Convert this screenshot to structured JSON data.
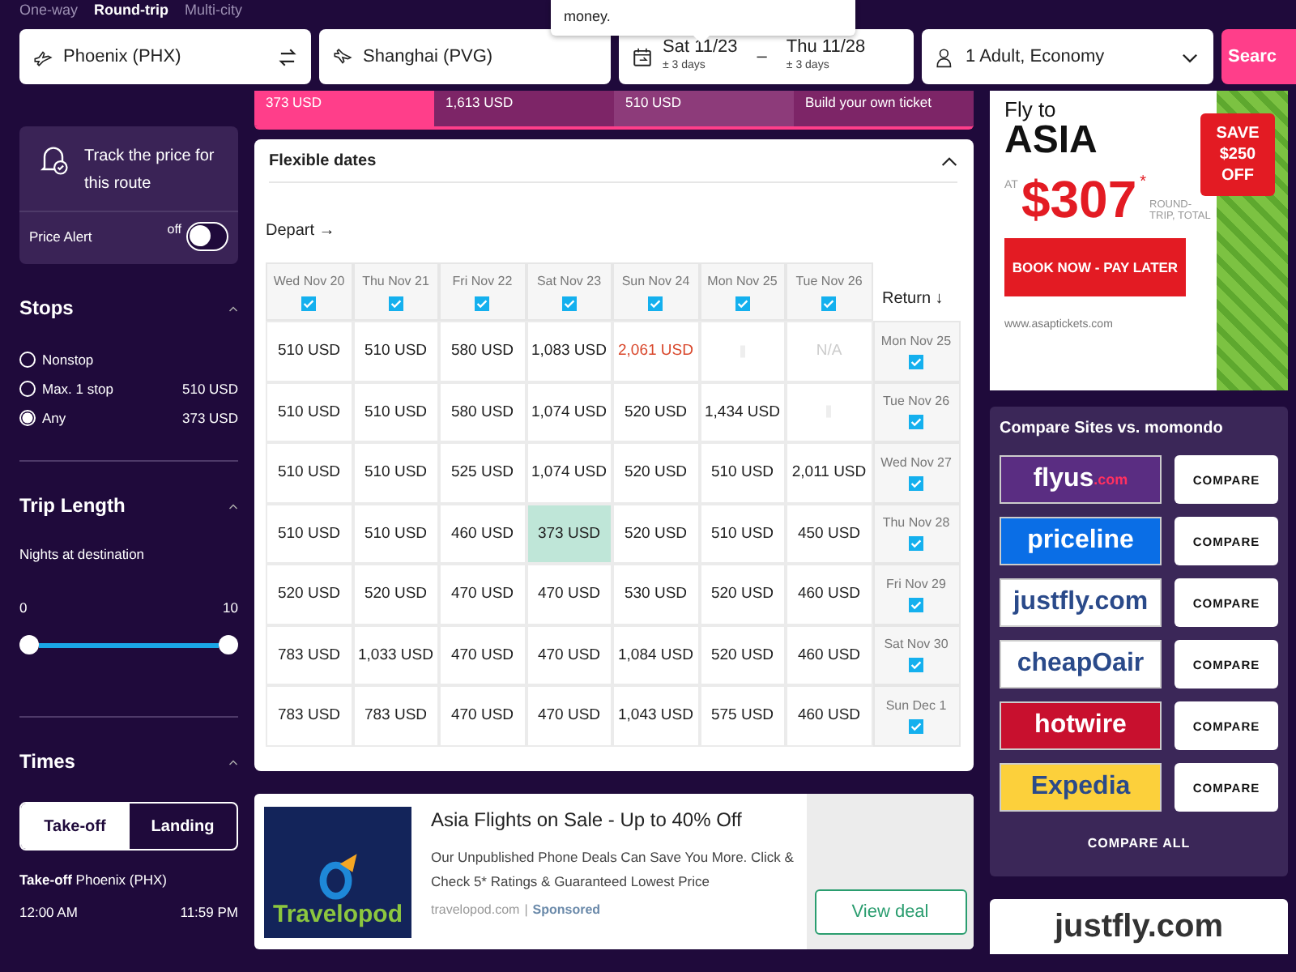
{
  "trip_types": [
    {
      "label": "One-way",
      "selected": false
    },
    {
      "label": "Round-trip",
      "selected": true
    },
    {
      "label": "Multi-city",
      "selected": false
    }
  ],
  "tooltip": {
    "text": "money."
  },
  "search": {
    "origin": "Phoenix (PHX)",
    "destination": "Shanghai (PVG)",
    "depart": {
      "date": "Sat 11/23",
      "flex": "± 3 days"
    },
    "separator": "–",
    "return": {
      "date": "Thu 11/28",
      "flex": "± 3 days"
    },
    "travelers": "1 Adult, Economy",
    "button": "Searc"
  },
  "sort_tabs": [
    {
      "label": "373 USD",
      "selected": true
    },
    {
      "label": "1,613 USD",
      "selected": false
    },
    {
      "label": "510 USD",
      "selected": false
    },
    {
      "label": "Build your own ticket",
      "selected": false
    }
  ],
  "price_alert": {
    "title": "Track the price for this route",
    "label": "Price Alert",
    "state_text": "off",
    "on": false
  },
  "stops": {
    "title": "Stops",
    "expanded": true,
    "options": [
      {
        "label": "Nonstop",
        "selected": false
      },
      {
        "label": "Max. 1 stop",
        "price": "510 USD",
        "selected": false
      },
      {
        "label": "Any",
        "price": "373 USD",
        "selected": true
      }
    ]
  },
  "trip_length": {
    "title": "Trip Length",
    "expanded": true,
    "subtitle": "Nights at destination",
    "min_label": "0",
    "max_label": "10",
    "thumbs": [
      {
        "level": 0
      },
      {
        "level": 1
      }
    ]
  },
  "times": {
    "title": "Times",
    "expanded": true,
    "tabs": [
      {
        "label": "Take-off",
        "selected": true
      },
      {
        "label": "Landing",
        "selected": false
      }
    ],
    "caption": "**Take-off** Phoenix (PHX)",
    "start": "12:00 AM",
    "end": "11:59 PM"
  },
  "flexible_dates": {
    "title": "Flexible dates",
    "expanded": true,
    "depart_label": "Depart →",
    "return_label": "Return ↓",
    "columns": [
      {
        "label": "Wed Nov 20",
        "checked": true
      },
      {
        "label": "Thu Nov 21",
        "checked": true
      },
      {
        "label": "Fri Nov 22",
        "checked": true
      },
      {
        "label": "Sat Nov 23",
        "checked": true
      },
      {
        "label": "Sun Nov 24",
        "checked": true
      },
      {
        "label": "Mon Nov 25",
        "checked": true
      },
      {
        "label": "Tue Nov 26",
        "checked": true
      }
    ],
    "rows": [
      {
        "label": "Mon Nov 25",
        "checked": true,
        "cells": [
          {
            "kind": "price",
            "text": "510 USD"
          },
          {
            "kind": "price",
            "text": "510 USD"
          },
          {
            "kind": "price",
            "text": "580 USD"
          },
          {
            "kind": "price",
            "text": "1,083 USD"
          },
          {
            "kind": "high",
            "text": "2,061 USD"
          },
          {
            "kind": "blank"
          },
          {
            "kind": "na",
            "text": "N/A"
          }
        ]
      },
      {
        "label": "Tue Nov 26",
        "checked": true,
        "cells": [
          {
            "kind": "price",
            "text": "510 USD"
          },
          {
            "kind": "price",
            "text": "510 USD"
          },
          {
            "kind": "price",
            "text": "580 USD"
          },
          {
            "kind": "price",
            "text": "1,074 USD"
          },
          {
            "kind": "price",
            "text": "520 USD"
          },
          {
            "kind": "price",
            "text": "1,434 USD"
          },
          {
            "kind": "blank"
          }
        ]
      },
      {
        "label": "Wed Nov 27",
        "checked": true,
        "cells": [
          {
            "kind": "price",
            "text": "510 USD"
          },
          {
            "kind": "price",
            "text": "510 USD"
          },
          {
            "kind": "price",
            "text": "525 USD"
          },
          {
            "kind": "price",
            "text": "1,074 USD"
          },
          {
            "kind": "price",
            "text": "520 USD"
          },
          {
            "kind": "price",
            "text": "510 USD"
          },
          {
            "kind": "price",
            "text": "2,011 USD"
          }
        ]
      },
      {
        "label": "Thu Nov 28",
        "checked": true,
        "cells": [
          {
            "kind": "price",
            "text": "510 USD"
          },
          {
            "kind": "price",
            "text": "510 USD"
          },
          {
            "kind": "price",
            "text": "460 USD"
          },
          {
            "kind": "best",
            "text": "373 USD"
          },
          {
            "kind": "price",
            "text": "520 USD"
          },
          {
            "kind": "price",
            "text": "510 USD"
          },
          {
            "kind": "price",
            "text": "450 USD"
          }
        ]
      },
      {
        "label": "Fri Nov 29",
        "checked": true,
        "cells": [
          {
            "kind": "price",
            "text": "520 USD"
          },
          {
            "kind": "price",
            "text": "520 USD"
          },
          {
            "kind": "price",
            "text": "470 USD"
          },
          {
            "kind": "price",
            "text": "470 USD"
          },
          {
            "kind": "price",
            "text": "530 USD"
          },
          {
            "kind": "price",
            "text": "520 USD"
          },
          {
            "kind": "price",
            "text": "460 USD"
          }
        ]
      },
      {
        "label": "Sat Nov 30",
        "checked": true,
        "cells": [
          {
            "kind": "price",
            "text": "783 USD"
          },
          {
            "kind": "price",
            "text": "1,033 USD"
          },
          {
            "kind": "price",
            "text": "470 USD"
          },
          {
            "kind": "price",
            "text": "470 USD"
          },
          {
            "kind": "price",
            "text": "1,084 USD"
          },
          {
            "kind": "price",
            "text": "520 USD"
          },
          {
            "kind": "price",
            "text": "460 USD"
          }
        ]
      },
      {
        "label": "Sun Dec 1",
        "checked": true,
        "cells": [
          {
            "kind": "price",
            "text": "783 USD"
          },
          {
            "kind": "price",
            "text": "783 USD"
          },
          {
            "kind": "price",
            "text": "470 USD"
          },
          {
            "kind": "price",
            "text": "470 USD"
          },
          {
            "kind": "price",
            "text": "1,043 USD"
          },
          {
            "kind": "price",
            "text": "575 USD"
          },
          {
            "kind": "price",
            "text": "460 USD"
          }
        ]
      }
    ]
  },
  "ad": {
    "logo": "Travelopod",
    "title": "Asia Flights on Sale - Up to 40% Off",
    "body": "Our Unpublished Phone Deals Can Save You More. Click & Check 5* Ratings & Guaranteed Lowest Price",
    "domain": "travelopod.com",
    "separator": "|",
    "sponsored": "Sponsored",
    "button": "View deal"
  },
  "banner": {
    "line1": "Fly to",
    "line2": "ASIA",
    "at": "AT",
    "price": "$307",
    "asterisk": "*",
    "note": "ROUND-TRIP, TOTAL",
    "button": "BOOK NOW - PAY LATER",
    "url": "www.asaptickets.com",
    "badge": "SAVE $250 OFF"
  },
  "compare": {
    "title": "Compare Sites vs. momondo",
    "sites": [
      {
        "name": "flyus",
        "suffix": ".com",
        "color": "#5a2d82",
        "button": "COMPARE"
      },
      {
        "name": "priceline",
        "color": "#0a6ee6",
        "button": "COMPARE"
      },
      {
        "name": "justfly.com",
        "color": "#ffffff",
        "button": "COMPARE"
      },
      {
        "name": "cheapOair",
        "color": "#ffffff",
        "button": "COMPARE"
      },
      {
        "name": "hotwire",
        "color": "#c8102e",
        "button": "COMPARE"
      },
      {
        "name": "Expedia",
        "color": "#fcd03b",
        "button": "COMPARE"
      }
    ],
    "all": "COMPARE ALL"
  },
  "bottom_card": {
    "logo": "justfly.com"
  }
}
